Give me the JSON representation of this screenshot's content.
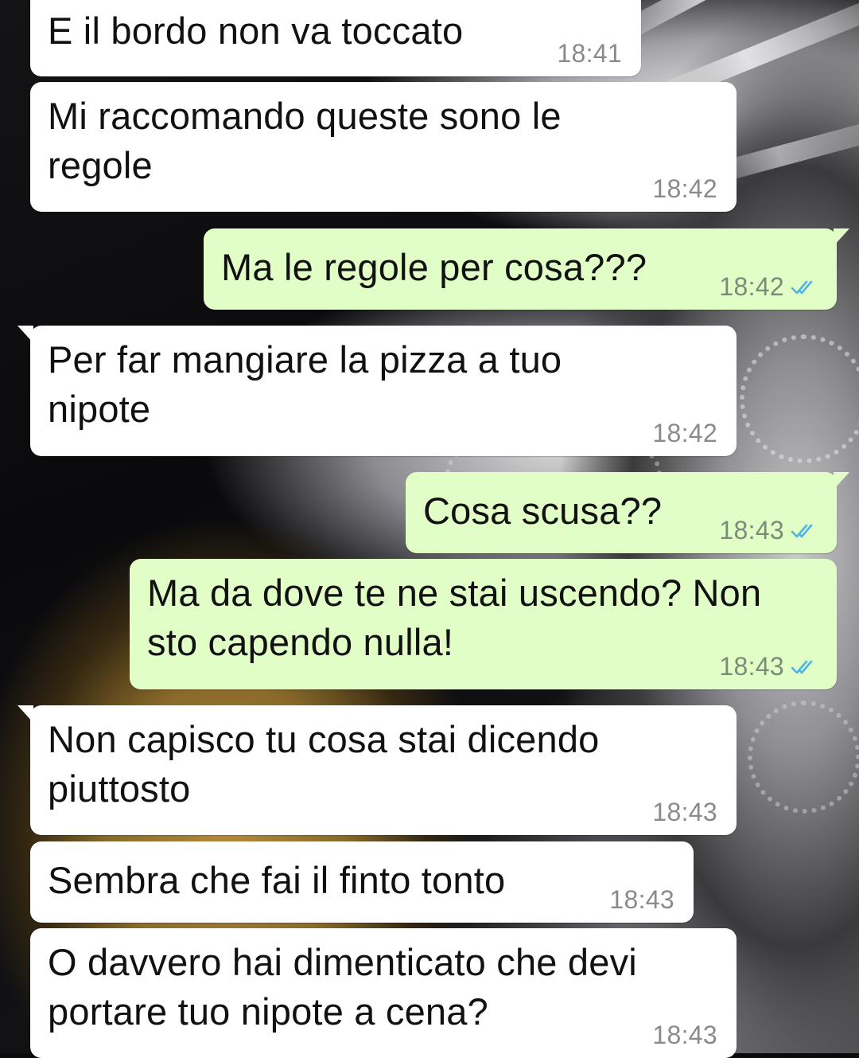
{
  "colors": {
    "incoming_bubble": "#ffffff",
    "outgoing_bubble": "#e1fec6",
    "read_check": "#4fb3e8",
    "time_text": "#8a8a8a"
  },
  "messages": [
    {
      "direction": "in",
      "text": "E il bordo non va toccato",
      "time": "18:41"
    },
    {
      "direction": "in",
      "text": "Mi raccomando queste sono le\nregole",
      "time": "18:42"
    },
    {
      "direction": "out",
      "text": "Ma le regole per cosa???",
      "time": "18:42",
      "status_icon": "double-check-icon"
    },
    {
      "direction": "in",
      "text": "Per far mangiare la pizza a tuo\nnipote",
      "time": "18:42"
    },
    {
      "direction": "out",
      "text": "Cosa scusa??",
      "time": "18:43",
      "status_icon": "double-check-icon"
    },
    {
      "direction": "out",
      "text": "Ma da dove te ne stai uscendo? Non\nsto capendo nulla!",
      "time": "18:43",
      "status_icon": "double-check-icon"
    },
    {
      "direction": "in",
      "text": "Non capisco tu cosa stai dicendo\npiuttosto",
      "time": "18:43"
    },
    {
      "direction": "in",
      "text": "Sembra che fai il finto tonto",
      "time": "18:43"
    },
    {
      "direction": "in",
      "text": "O davvero hai dimenticato che devi\nportare tuo nipote a cena?",
      "time": "18:43"
    }
  ]
}
